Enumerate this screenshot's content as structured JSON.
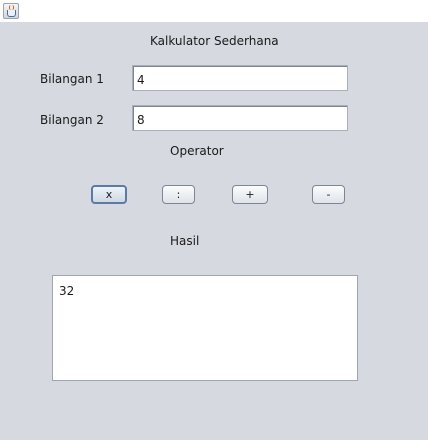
{
  "window": {
    "icon": "java-cup-icon"
  },
  "form": {
    "title": "Kalkulator Sederhana",
    "label_bilangan1": "Bilangan 1",
    "value_bilangan1": "4",
    "label_bilangan2": "Bilangan 2",
    "value_bilangan2": "8",
    "label_operator": "Operator",
    "buttons": {
      "multiply": "x",
      "divide": ":",
      "add": "+",
      "subtract": "-"
    },
    "label_hasil": "Hasil",
    "result": "32"
  }
}
